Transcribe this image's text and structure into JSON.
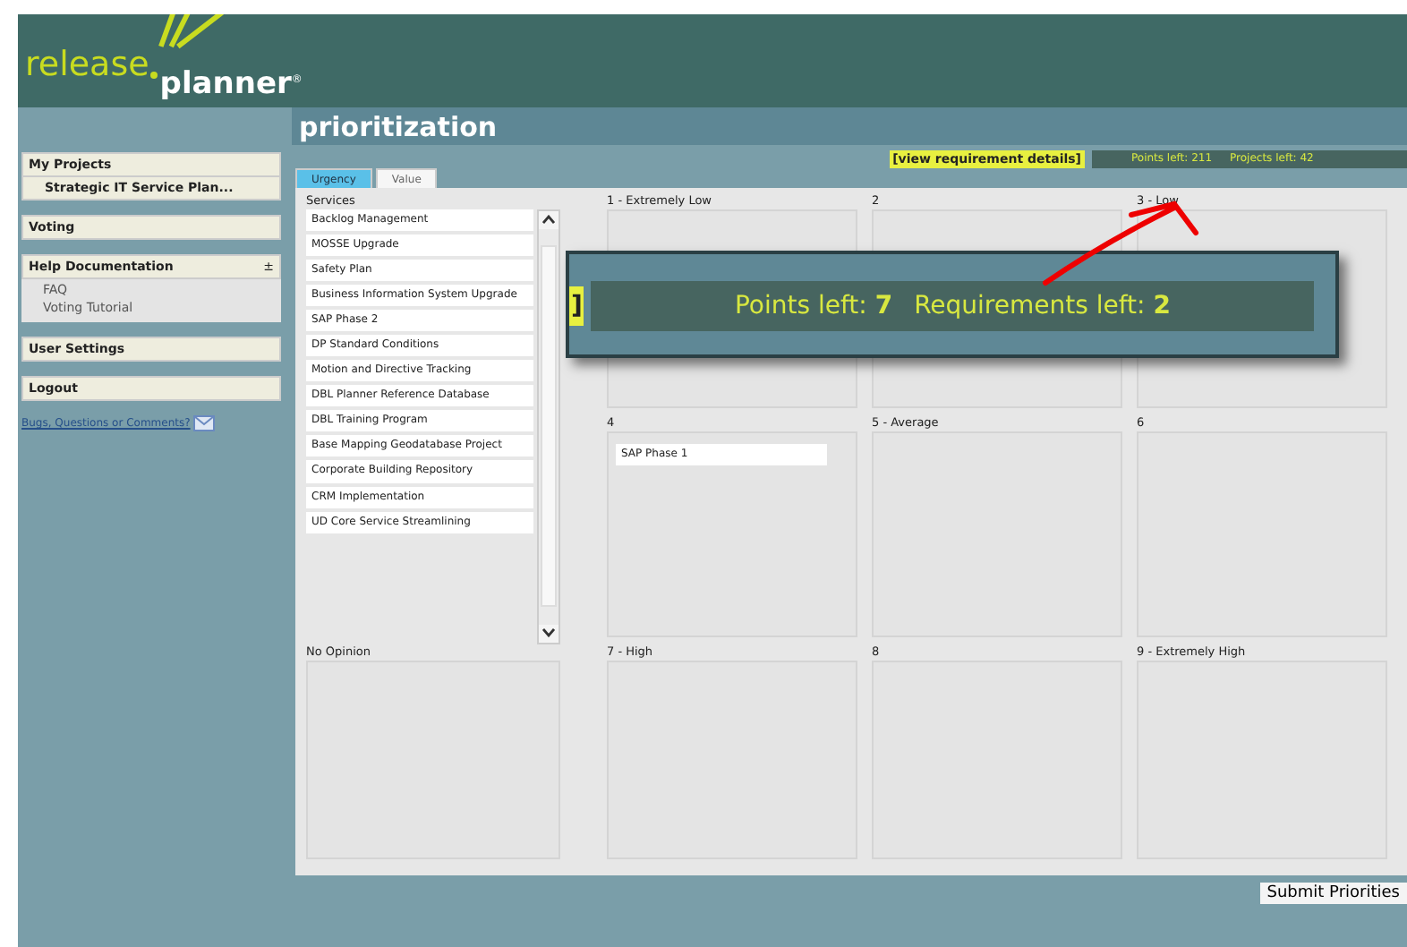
{
  "logo": {
    "word_1": "release",
    "word_2": "planner",
    "mark": "®"
  },
  "sidebar": {
    "sections": [
      {
        "title": "My Projects",
        "kind": "project",
        "items": [
          "Strategic IT Service Plan..."
        ]
      },
      {
        "title": "Voting",
        "kind": "link"
      },
      {
        "title": "Help Documentation",
        "kind": "collapsible",
        "toggle": "±",
        "items": [
          "FAQ",
          "Voting Tutorial"
        ]
      },
      {
        "title": "User Settings",
        "kind": "link"
      },
      {
        "title": "Logout",
        "kind": "link"
      }
    ],
    "feedback_link": "Bugs, Questions or Comments?"
  },
  "page_title": "prioritization",
  "details_link": "[view requirement details]",
  "totals": [
    "Points left: 211",
    "Projects left: 42"
  ],
  "tabs": [
    {
      "label": "Urgency",
      "selected": true
    },
    {
      "label": "Value",
      "selected": false
    }
  ],
  "services": {
    "label": "Services",
    "items": [
      "Backlog Management",
      "MOSSE Upgrade",
      "Safety Plan",
      "Business Information System Upgrade",
      "SAP Phase 2",
      "DP Standard Conditions",
      "Motion and Directive Tracking",
      "DBL Planner Reference Database",
      "DBL Training Program",
      "Base Mapping Geodatabase Project",
      "Corporate Building Repository",
      "CRM Implementation",
      "UD Core Service Streamlining"
    ]
  },
  "buckets": [
    {
      "label": "1 - Extremely Low"
    },
    {
      "label": "2"
    },
    {
      "label": "3 - Low"
    },
    {
      "label": "4",
      "items": [
        "SAP Phase 1"
      ]
    },
    {
      "label": "5 - Average"
    },
    {
      "label": "6"
    },
    {
      "label": "7 - High"
    },
    {
      "label": "8"
    },
    {
      "label": "9 - Extremely High"
    }
  ],
  "no_opinion": {
    "label": "No Opinion"
  },
  "callout": {
    "fragment": "]",
    "texts": [
      "Points left: **7**",
      "Requirements left: **2**"
    ]
  },
  "submit_button": "Submit Priorities"
}
